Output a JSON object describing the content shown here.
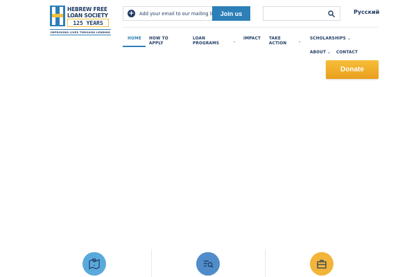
{
  "logo": {
    "line1": "HEBREW FREE",
    "line2": "LOAN SOCIETY",
    "years": "125 YEARS",
    "tagline": "IMPROVING LIVES THROUGH LENDING"
  },
  "mailing": {
    "text": "Add your email to our mailing list",
    "join_label": "Join us"
  },
  "search": {
    "placeholder": ""
  },
  "language": "Русский",
  "nav": {
    "home": "HOME",
    "how_to_apply_1": "HOW TO",
    "how_to_apply_2": "APPLY",
    "loan_programs_1": "LOAN",
    "loan_programs_2": "PROGRAMS",
    "impact": "IMPACT",
    "take_action_1": "TAKE",
    "take_action_2": "ACTION",
    "scholarships": "SCHOLARSHIPS",
    "about": "ABOUT",
    "contact": "CONTACT"
  },
  "donate_label": "Donate",
  "colors": {
    "navy": "#1f3b63",
    "blue": "#2d7fb8",
    "gold": "#f3c23c",
    "orange": "#f0a928",
    "feature_blue_light": "#5aa9dc",
    "feature_blue": "#4f8cc9"
  },
  "features": {
    "icon1": "map-pin-icon",
    "icon2": "search-list-icon",
    "icon3": "briefcase-icon"
  }
}
